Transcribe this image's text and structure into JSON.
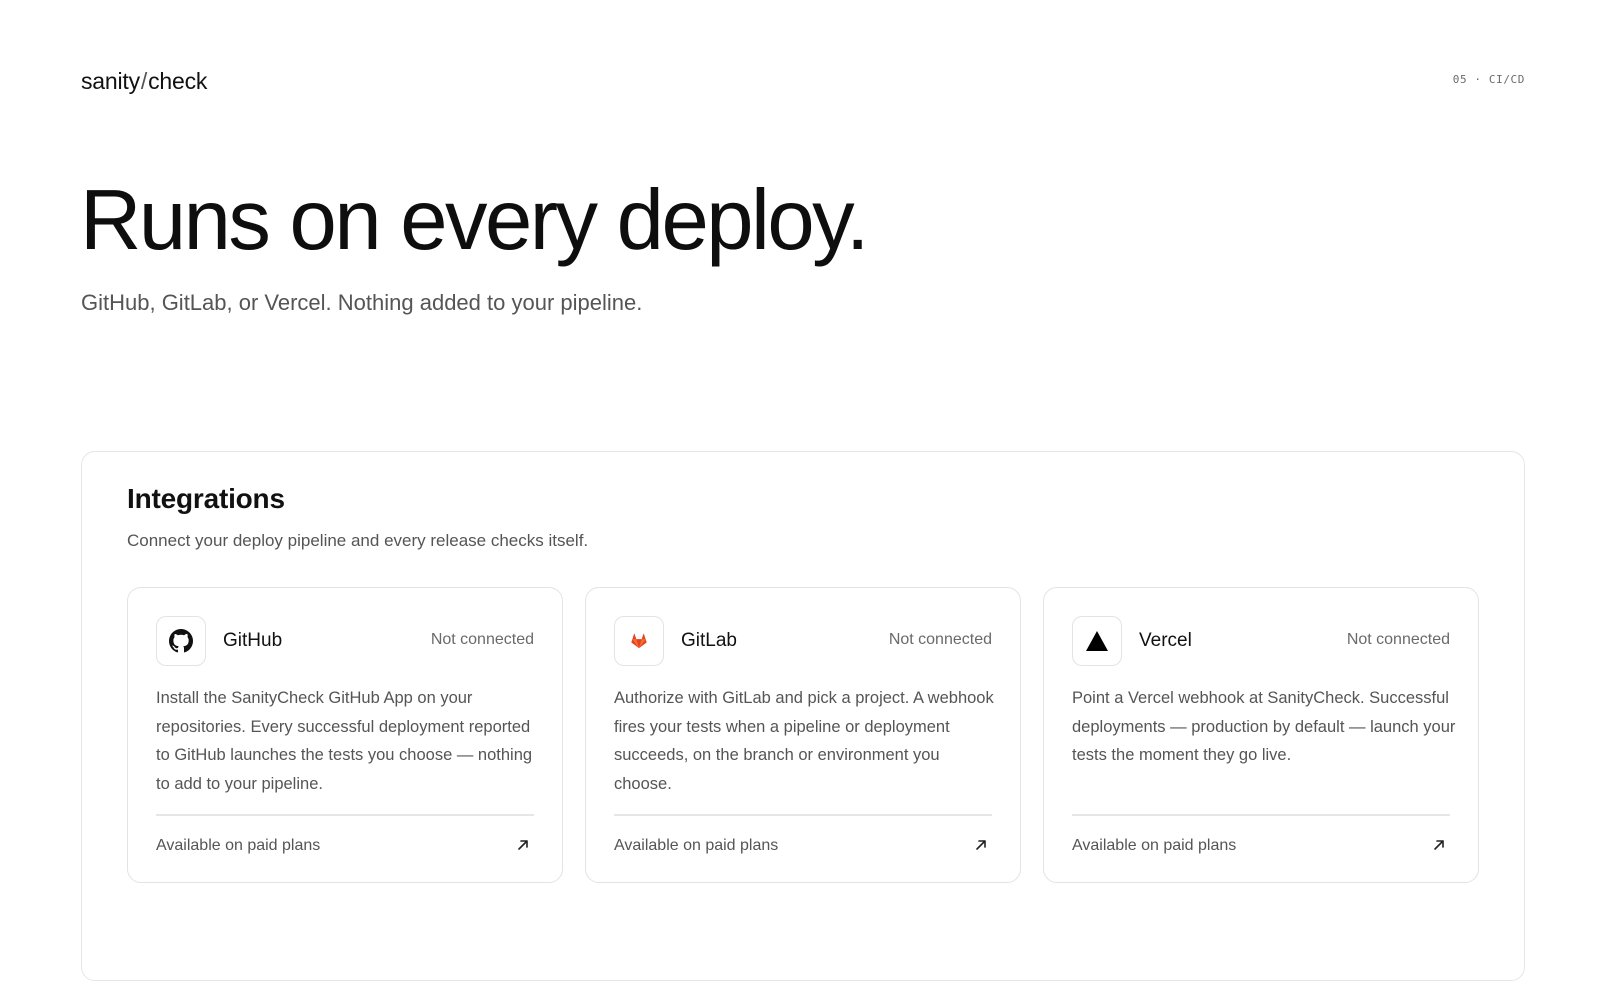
{
  "header": {
    "logo_left": "sanity",
    "logo_sep": "/",
    "logo_right": "check",
    "section_tag": "05 · CI/CD"
  },
  "hero": {
    "title": "Runs on every deploy.",
    "subtitle": "GitHub, GitLab, or Vercel. Nothing added to your pipeline."
  },
  "integrations": {
    "title": "Integrations",
    "subtitle": "Connect your deploy pipeline and every release checks itself.",
    "cards": [
      {
        "name": "GitHub",
        "icon": "github-icon",
        "status": "Not connected",
        "description": "Install the SanityCheck GitHub App on your repositories. Every successful deployment reported to GitHub launches the tests you choose — nothing to add to your pipeline.",
        "footer": "Available on paid plans"
      },
      {
        "name": "GitLab",
        "icon": "gitlab-icon",
        "status": "Not connected",
        "description": "Authorize with GitLab and pick a project. A webhook fires your tests when a pipeline or deployment succeeds, on the branch or environment you choose.",
        "footer": "Available on paid plans"
      },
      {
        "name": "Vercel",
        "icon": "vercel-icon",
        "status": "Not connected",
        "description": "Point a Vercel webhook at SanityCheck. Successful deployments — production by default — launch your tests the moment they go live.",
        "footer": "Available on paid plans"
      }
    ]
  },
  "colors": {
    "text_primary": "#111111",
    "text_secondary": "#555555",
    "border": "#e3e3e3",
    "gitlab_orange": "#e24329"
  }
}
